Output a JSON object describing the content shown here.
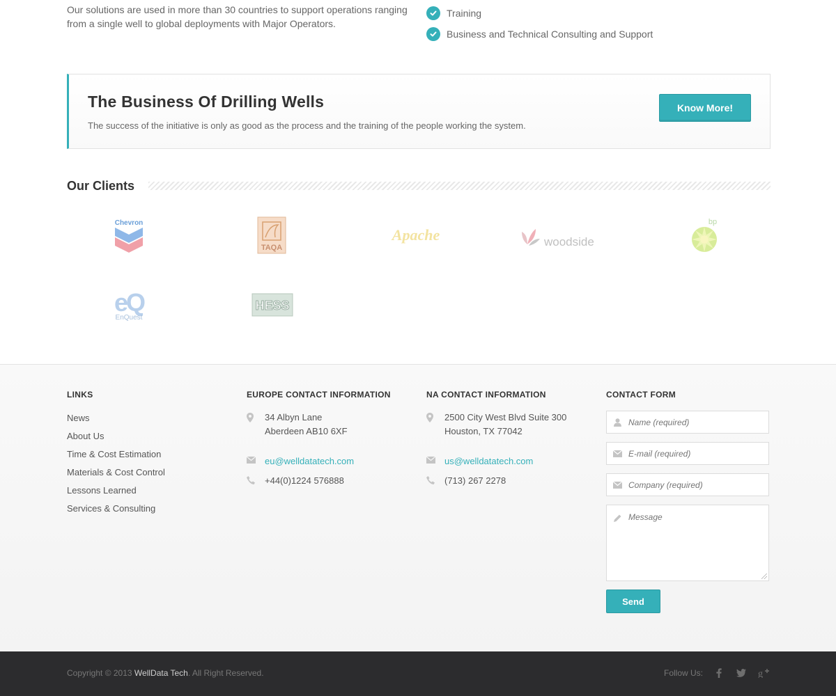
{
  "intro": {
    "text": "Our solutions are used in more than 30 countries to support operations ranging from a single well to global deployments with Major Operators.",
    "checklist": [
      "Training",
      "Business and Technical Consulting and Support"
    ]
  },
  "promo": {
    "title": "The Business Of Drilling Wells",
    "subtitle": "The success of the initiative is only as good as the process and the training of the people working the system.",
    "button_label": "Know More!"
  },
  "clients": {
    "title": "Our Clients",
    "logos": {
      "chevron": "Chevron",
      "taqa": "TAQA",
      "apache": "Apache",
      "woodside": "woodside",
      "bp": "bp",
      "enquest_mark": "eQ",
      "enquest": "EnQuest",
      "hess": "HESS"
    }
  },
  "footer": {
    "links": {
      "heading": "LINKS",
      "items": [
        "News",
        "About Us",
        "Time & Cost Estimation",
        "Materials & Cost Control",
        "Lessons Learned",
        "Services & Consulting"
      ]
    },
    "europe": {
      "heading": "EUROPE CONTACT INFORMATION",
      "address_line1": "34 Albyn Lane",
      "address_line2": "Aberdeen AB10 6XF",
      "email": "eu@welldatatech.com",
      "phone": "+44(0)1224  576888"
    },
    "na": {
      "heading": "NA CONTACT INFORMATION",
      "address_line1": "2500 City West Blvd Suite 300",
      "address_line2": "Houston, TX 77042",
      "email": "us@welldatatech.com",
      "phone": "(713) 267 2278"
    },
    "form": {
      "heading": "CONTACT FORM",
      "name_placeholder": "Name (required)",
      "email_placeholder": "E-mail (required)",
      "company_placeholder": "Company (required)",
      "message_placeholder": "Message",
      "send_label": "Send"
    }
  },
  "bottom": {
    "copyright_prefix": "Copyright © 2013 ",
    "brand": "WellData Tech",
    "copyright_suffix": ". All Right Reserved.",
    "follow_label": "Follow Us:",
    "social_icons": [
      "facebook-icon",
      "twitter-icon",
      "google-plus-icon"
    ]
  },
  "colors": {
    "accent": "#35b0b9",
    "footer_dark": "#2c2c2e"
  }
}
